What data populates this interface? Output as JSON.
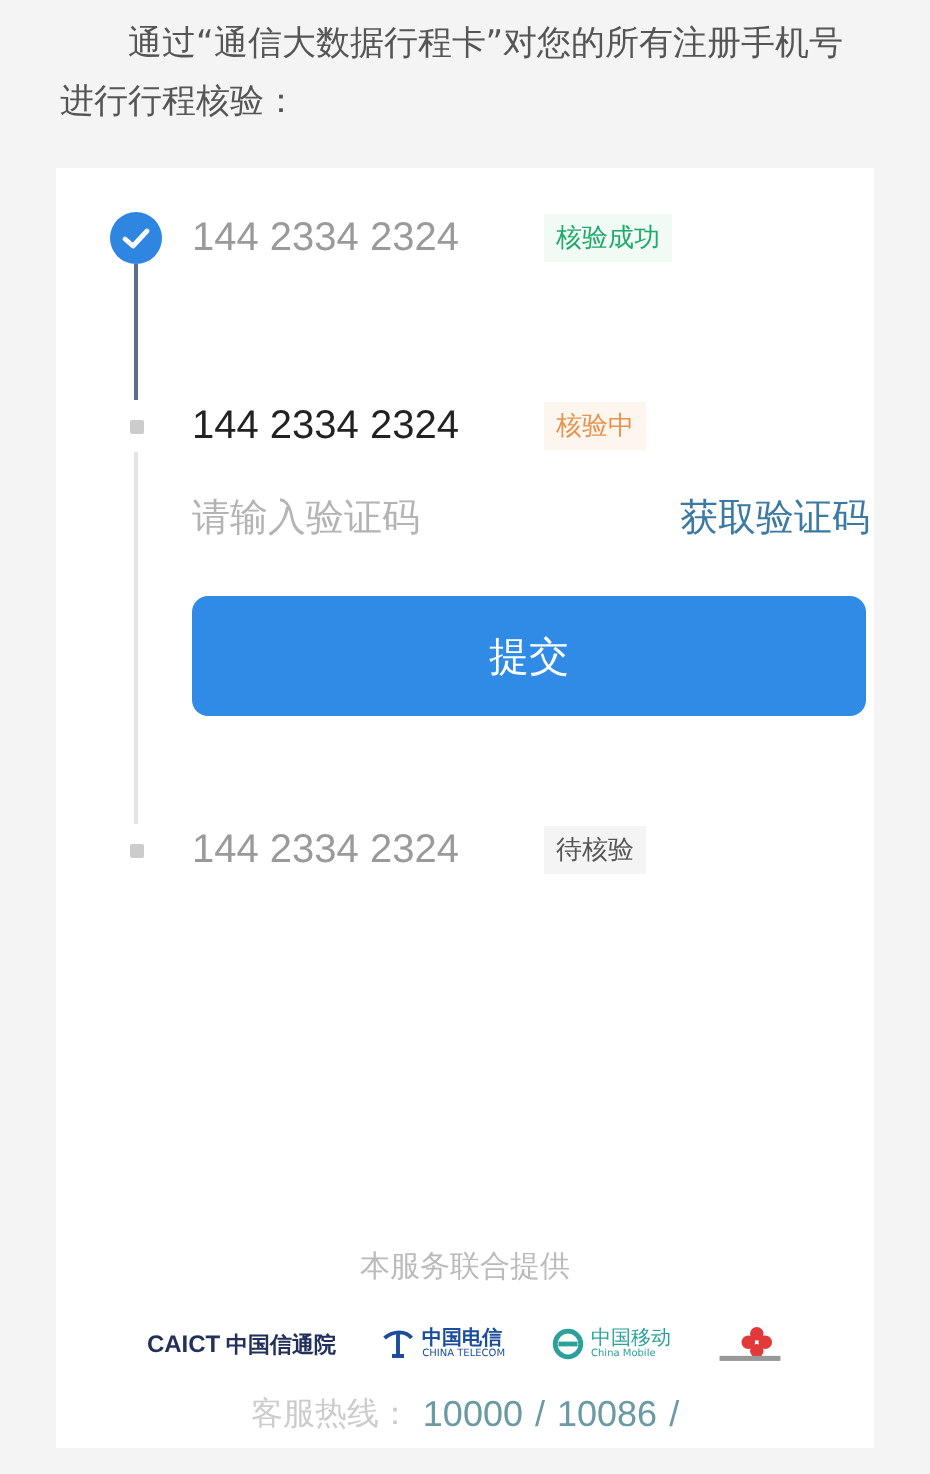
{
  "intro": "通过“通信大数据行程卡”对您的所有注册手机号进行行程核验：",
  "steps": [
    {
      "phone": "144 2334 2324",
      "status": "核验成功",
      "kind": "success"
    },
    {
      "phone": "144 2334 2324",
      "status": "核验中",
      "kind": "active",
      "code_field": {
        "placeholder": "请输入验证码"
      },
      "get_code": "获取验证码",
      "submit": "提交"
    },
    {
      "phone": "144 2334 2324",
      "status": "待核验",
      "kind": "waiting"
    }
  ],
  "footer": {
    "provided_by": "本服务联合提供",
    "logos": [
      {
        "kind": "caict",
        "name": "CAICT",
        "text": "中国信通院"
      },
      {
        "kind": "telecom",
        "text": "中国电信",
        "sub": "CHINA TELECOM"
      },
      {
        "kind": "mobile",
        "text": "中国移动",
        "sub": "China Mobile"
      },
      {
        "kind": "unicom"
      }
    ],
    "hotline_label": "客服热线：",
    "hotline": [
      "10000",
      "/",
      "10086",
      "/"
    ]
  }
}
